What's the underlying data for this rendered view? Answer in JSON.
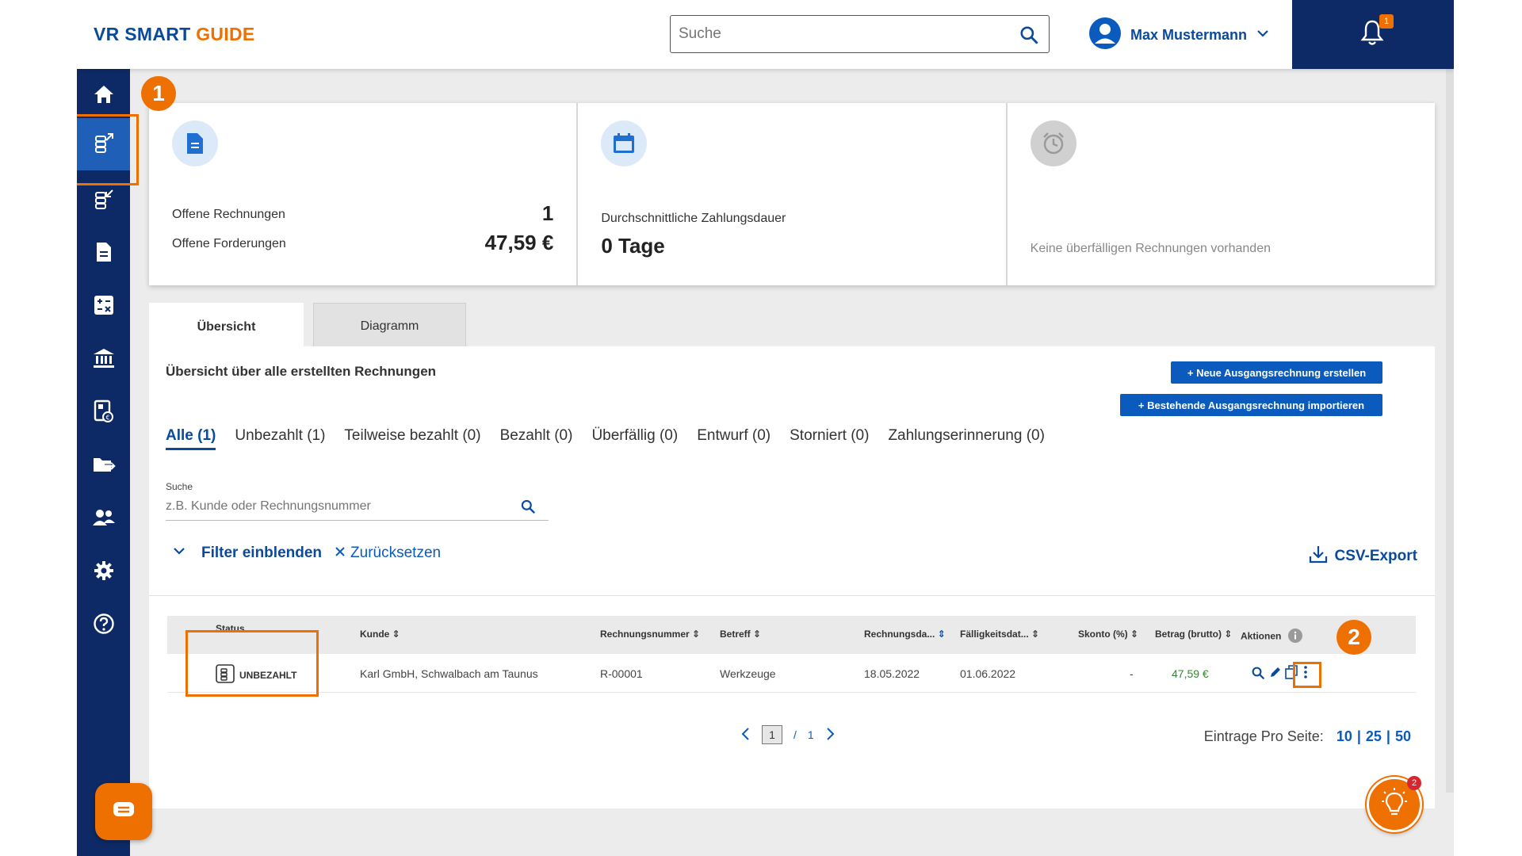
{
  "header": {
    "logo_part1": "VR SMART ",
    "logo_part2": "GUIDE",
    "search_placeholder": "Suche",
    "user_name": "Max Mustermann",
    "notifications_count": "1"
  },
  "sidebar": {
    "items": [
      {
        "icon": "home-icon"
      },
      {
        "icon": "outgoing-invoices-icon",
        "active": true
      },
      {
        "icon": "incoming-invoices-icon"
      },
      {
        "icon": "document-icon"
      },
      {
        "icon": "calculator-icon"
      },
      {
        "icon": "bank-icon"
      },
      {
        "icon": "receipt-icon"
      },
      {
        "icon": "folder-export-icon"
      },
      {
        "icon": "people-icon"
      },
      {
        "icon": "settings-icon"
      },
      {
        "icon": "help-icon"
      }
    ]
  },
  "annotations": {
    "marker1": "1",
    "marker2": "2"
  },
  "cards": {
    "open": {
      "label1": "Offene Rechnungen",
      "value1": "1",
      "label2": "Offene Forderungen",
      "value2": "47,59 €"
    },
    "avg": {
      "label": "Durchschnittliche Zahlungsdauer",
      "value": "0 Tage"
    },
    "overdue": {
      "text": "Keine überfälligen Rechnungen vorhanden"
    }
  },
  "tabs": [
    {
      "label": "Übersicht",
      "active": true
    },
    {
      "label": "Diagramm",
      "active": false
    }
  ],
  "panel": {
    "title": "Übersicht über alle erstellten Rechnungen",
    "btn_new": "+ Neue Ausgangsrechnung erstellen",
    "btn_import": "+ Bestehende Ausgangsrechnung importieren",
    "filter_tabs": [
      {
        "label": "Alle (1)",
        "active": true
      },
      {
        "label": "Unbezahlt (1)"
      },
      {
        "label": "Teilweise bezahlt (0)"
      },
      {
        "label": "Bezahlt (0)"
      },
      {
        "label": "Überfällig (0)"
      },
      {
        "label": "Entwurf (0)"
      },
      {
        "label": "Storniert (0)"
      },
      {
        "label": "Zahlungserinnerung (0)"
      }
    ],
    "search_label": "Suche",
    "search_placeholder": "z.B. Kunde oder Rechnungsnummer",
    "filter_show": "Filter einblenden",
    "filter_reset": "Zurücksetzen",
    "csv_export": "CSV-Export"
  },
  "table": {
    "columns": {
      "status": "Status",
      "kunde": "Kunde",
      "rechnungsnummer": "Rechnungsnummer",
      "betreff": "Betreff",
      "rechnungsdatum": "Rechnungsda...",
      "faelligkeitsdatum": "Fälligkeitsdat...",
      "skonto": "Skonto (%)",
      "betrag": "Betrag (brutto)",
      "aktionen": "Aktionen"
    },
    "rows": [
      {
        "status": "UNBEZAHLT",
        "kunde": "Karl GmbH, Schwalbach am Taunus",
        "rechnungsnummer": "R-00001",
        "betreff": "Werkzeuge",
        "rechnungsdatum": "18.05.2022",
        "faelligkeitsdatum": "01.06.2022",
        "skonto": "-",
        "betrag": "47,59 €"
      }
    ]
  },
  "pagination": {
    "current": "1",
    "separator": "/",
    "total": "1"
  },
  "per_page": {
    "label": "Eintrage Pro Seite:",
    "options": [
      "10",
      "25",
      "50"
    ],
    "divider": "|"
  },
  "help_bulb_badge": "2",
  "colors": {
    "navy": "#0d2a66",
    "blue": "#0a5bbd",
    "orange": "#ee7000",
    "green_amount": "#2e8b2e"
  }
}
